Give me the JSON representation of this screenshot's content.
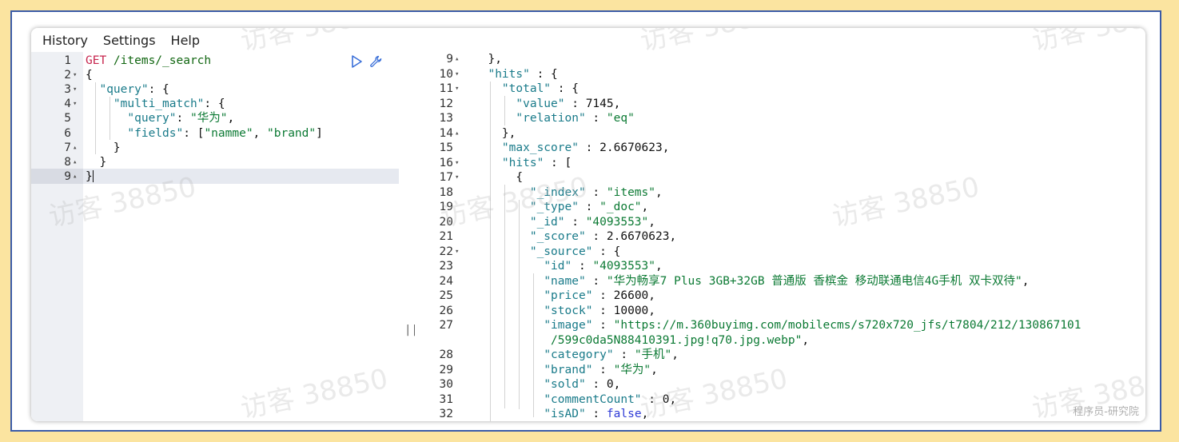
{
  "menu": {
    "items": [
      "History",
      "Settings",
      "Help"
    ]
  },
  "request": {
    "lines": [
      {
        "n": "1",
        "fold": "",
        "segments": [
          {
            "t": "GET ",
            "c": "k-method"
          },
          {
            "t": "/items/_search",
            "c": "k-url"
          }
        ]
      },
      {
        "n": "2",
        "fold": "▾",
        "segments": [
          {
            "t": "{",
            "c": "k-punc"
          }
        ]
      },
      {
        "n": "3",
        "fold": "▾",
        "segments": [
          {
            "t": "  ",
            "c": "k-punc"
          },
          {
            "t": "\"query\"",
            "c": "k-key"
          },
          {
            "t": ": {",
            "c": "k-punc"
          }
        ]
      },
      {
        "n": "4",
        "fold": "▾",
        "segments": [
          {
            "t": "    ",
            "c": "k-punc"
          },
          {
            "t": "\"multi_match\"",
            "c": "k-key"
          },
          {
            "t": ": {",
            "c": "k-punc"
          }
        ]
      },
      {
        "n": "5",
        "fold": "",
        "segments": [
          {
            "t": "      ",
            "c": "k-punc"
          },
          {
            "t": "\"query\"",
            "c": "k-key"
          },
          {
            "t": ": ",
            "c": "k-punc"
          },
          {
            "t": "\"华为\"",
            "c": "k-str"
          },
          {
            "t": ",",
            "c": "k-punc"
          }
        ]
      },
      {
        "n": "6",
        "fold": "",
        "segments": [
          {
            "t": "      ",
            "c": "k-punc"
          },
          {
            "t": "\"fields\"",
            "c": "k-key"
          },
          {
            "t": ": [",
            "c": "k-punc"
          },
          {
            "t": "\"namme\"",
            "c": "k-str"
          },
          {
            "t": ", ",
            "c": "k-punc"
          },
          {
            "t": "\"brand\"",
            "c": "k-str"
          },
          {
            "t": "]",
            "c": "k-punc"
          }
        ]
      },
      {
        "n": "7",
        "fold": "▴",
        "segments": [
          {
            "t": "    }",
            "c": "k-punc"
          }
        ]
      },
      {
        "n": "8",
        "fold": "▴",
        "segments": [
          {
            "t": "  }",
            "c": "k-punc"
          }
        ]
      },
      {
        "n": "9",
        "fold": "▴",
        "segments": [
          {
            "t": "}",
            "c": "k-punc"
          }
        ]
      }
    ]
  },
  "response": {
    "lines": [
      {
        "n": "9",
        "fold": "▴",
        "segments": [
          {
            "t": "  },",
            "c": "k-punc"
          }
        ]
      },
      {
        "n": "10",
        "fold": "▾",
        "segments": [
          {
            "t": "  ",
            "c": "k-punc"
          },
          {
            "t": "\"hits\"",
            "c": "k-key"
          },
          {
            "t": " : {",
            "c": "k-punc"
          }
        ]
      },
      {
        "n": "11",
        "fold": "▾",
        "segments": [
          {
            "t": "    ",
            "c": "k-punc"
          },
          {
            "t": "\"total\"",
            "c": "k-key"
          },
          {
            "t": " : {",
            "c": "k-punc"
          }
        ]
      },
      {
        "n": "12",
        "fold": "",
        "segments": [
          {
            "t": "      ",
            "c": "k-punc"
          },
          {
            "t": "\"value\"",
            "c": "k-key"
          },
          {
            "t": " : ",
            "c": "k-punc"
          },
          {
            "t": "7145",
            "c": "k-num"
          },
          {
            "t": ",",
            "c": "k-punc"
          }
        ]
      },
      {
        "n": "13",
        "fold": "",
        "segments": [
          {
            "t": "      ",
            "c": "k-punc"
          },
          {
            "t": "\"relation\"",
            "c": "k-key"
          },
          {
            "t": " : ",
            "c": "k-punc"
          },
          {
            "t": "\"eq\"",
            "c": "k-str"
          }
        ]
      },
      {
        "n": "14",
        "fold": "▴",
        "segments": [
          {
            "t": "    },",
            "c": "k-punc"
          }
        ]
      },
      {
        "n": "15",
        "fold": "",
        "segments": [
          {
            "t": "    ",
            "c": "k-punc"
          },
          {
            "t": "\"max_score\"",
            "c": "k-key"
          },
          {
            "t": " : ",
            "c": "k-punc"
          },
          {
            "t": "2.6670623",
            "c": "k-num"
          },
          {
            "t": ",",
            "c": "k-punc"
          }
        ]
      },
      {
        "n": "16",
        "fold": "▾",
        "segments": [
          {
            "t": "    ",
            "c": "k-punc"
          },
          {
            "t": "\"hits\"",
            "c": "k-key"
          },
          {
            "t": " : [",
            "c": "k-punc"
          }
        ]
      },
      {
        "n": "17",
        "fold": "▾",
        "segments": [
          {
            "t": "      {",
            "c": "k-punc"
          }
        ]
      },
      {
        "n": "18",
        "fold": "",
        "segments": [
          {
            "t": "        ",
            "c": "k-punc"
          },
          {
            "t": "\"_index\"",
            "c": "k-key"
          },
          {
            "t": " : ",
            "c": "k-punc"
          },
          {
            "t": "\"items\"",
            "c": "k-str"
          },
          {
            "t": ",",
            "c": "k-punc"
          }
        ]
      },
      {
        "n": "19",
        "fold": "",
        "segments": [
          {
            "t": "        ",
            "c": "k-punc"
          },
          {
            "t": "\"_type\"",
            "c": "k-key"
          },
          {
            "t": " : ",
            "c": "k-punc"
          },
          {
            "t": "\"_doc\"",
            "c": "k-str"
          },
          {
            "t": ",",
            "c": "k-punc"
          }
        ]
      },
      {
        "n": "20",
        "fold": "",
        "segments": [
          {
            "t": "        ",
            "c": "k-punc"
          },
          {
            "t": "\"_id\"",
            "c": "k-key"
          },
          {
            "t": " : ",
            "c": "k-punc"
          },
          {
            "t": "\"4093553\"",
            "c": "k-str"
          },
          {
            "t": ",",
            "c": "k-punc"
          }
        ]
      },
      {
        "n": "21",
        "fold": "",
        "segments": [
          {
            "t": "        ",
            "c": "k-punc"
          },
          {
            "t": "\"_score\"",
            "c": "k-key"
          },
          {
            "t": " : ",
            "c": "k-punc"
          },
          {
            "t": "2.6670623",
            "c": "k-num"
          },
          {
            "t": ",",
            "c": "k-punc"
          }
        ]
      },
      {
        "n": "22",
        "fold": "▾",
        "segments": [
          {
            "t": "        ",
            "c": "k-punc"
          },
          {
            "t": "\"_source\"",
            "c": "k-key"
          },
          {
            "t": " : {",
            "c": "k-punc"
          }
        ]
      },
      {
        "n": "23",
        "fold": "",
        "segments": [
          {
            "t": "          ",
            "c": "k-punc"
          },
          {
            "t": "\"id\"",
            "c": "k-key"
          },
          {
            "t": " : ",
            "c": "k-punc"
          },
          {
            "t": "\"4093553\"",
            "c": "k-str"
          },
          {
            "t": ",",
            "c": "k-punc"
          }
        ]
      },
      {
        "n": "24",
        "fold": "",
        "segments": [
          {
            "t": "          ",
            "c": "k-punc"
          },
          {
            "t": "\"name\"",
            "c": "k-key"
          },
          {
            "t": " : ",
            "c": "k-punc"
          },
          {
            "t": "\"华为畅享7 Plus 3GB+32GB 普通版 香槟金 移动联通电信4G手机 双卡双待\"",
            "c": "k-str"
          },
          {
            "t": ",",
            "c": "k-punc"
          }
        ]
      },
      {
        "n": "25",
        "fold": "",
        "segments": [
          {
            "t": "          ",
            "c": "k-punc"
          },
          {
            "t": "\"price\"",
            "c": "k-key"
          },
          {
            "t": " : ",
            "c": "k-punc"
          },
          {
            "t": "26600",
            "c": "k-num"
          },
          {
            "t": ",",
            "c": "k-punc"
          }
        ]
      },
      {
        "n": "26",
        "fold": "",
        "segments": [
          {
            "t": "          ",
            "c": "k-punc"
          },
          {
            "t": "\"stock\"",
            "c": "k-key"
          },
          {
            "t": " : ",
            "c": "k-punc"
          },
          {
            "t": "10000",
            "c": "k-num"
          },
          {
            "t": ",",
            "c": "k-punc"
          }
        ]
      },
      {
        "n": "27",
        "fold": "",
        "segments": [
          {
            "t": "          ",
            "c": "k-punc"
          },
          {
            "t": "\"image\"",
            "c": "k-key"
          },
          {
            "t": " : ",
            "c": "k-punc"
          },
          {
            "t": "\"https://m.360buyimg.com/mobilecms/s720x720_jfs/t7804/212/130867101",
            "c": "k-str"
          }
        ]
      },
      {
        "n": "",
        "fold": "",
        "segments": [
          {
            "t": "           ",
            "c": "k-punc"
          },
          {
            "t": "/599c0da5N88410391.jpg!q70.jpg.webp\"",
            "c": "k-str"
          },
          {
            "t": ",",
            "c": "k-punc"
          }
        ]
      },
      {
        "n": "28",
        "fold": "",
        "segments": [
          {
            "t": "          ",
            "c": "k-punc"
          },
          {
            "t": "\"category\"",
            "c": "k-key"
          },
          {
            "t": " : ",
            "c": "k-punc"
          },
          {
            "t": "\"手机\"",
            "c": "k-str"
          },
          {
            "t": ",",
            "c": "k-punc"
          }
        ]
      },
      {
        "n": "29",
        "fold": "",
        "segments": [
          {
            "t": "          ",
            "c": "k-punc"
          },
          {
            "t": "\"brand\"",
            "c": "k-key"
          },
          {
            "t": " : ",
            "c": "k-punc"
          },
          {
            "t": "\"华为\"",
            "c": "k-str"
          },
          {
            "t": ",",
            "c": "k-punc"
          }
        ]
      },
      {
        "n": "30",
        "fold": "",
        "segments": [
          {
            "t": "          ",
            "c": "k-punc"
          },
          {
            "t": "\"sold\"",
            "c": "k-key"
          },
          {
            "t": " : ",
            "c": "k-punc"
          },
          {
            "t": "0",
            "c": "k-num"
          },
          {
            "t": ",",
            "c": "k-punc"
          }
        ]
      },
      {
        "n": "31",
        "fold": "",
        "segments": [
          {
            "t": "          ",
            "c": "k-punc"
          },
          {
            "t": "\"commentCount\"",
            "c": "k-key"
          },
          {
            "t": " : ",
            "c": "k-punc"
          },
          {
            "t": "0",
            "c": "k-num"
          },
          {
            "t": ",",
            "c": "k-punc"
          }
        ]
      },
      {
        "n": "32",
        "fold": "",
        "segments": [
          {
            "t": "          ",
            "c": "k-punc"
          },
          {
            "t": "\"isAD\"",
            "c": "k-key"
          },
          {
            "t": " : ",
            "c": "k-punc"
          },
          {
            "t": "false",
            "c": "k-bool"
          },
          {
            "t": ",",
            "c": "k-punc"
          }
        ]
      }
    ]
  },
  "splitter_glyph": "||",
  "watermarks": [
    "访客 38850",
    "访客 38850",
    "访客 38850",
    "访客 38850",
    "访客 38850",
    "访客 38850",
    "访客 38850",
    "访客 38850",
    "访客 38850"
  ],
  "corner_watermark": "程序员-研究院",
  "icons": {
    "run": "play-icon",
    "settings": "wrench-icon"
  }
}
